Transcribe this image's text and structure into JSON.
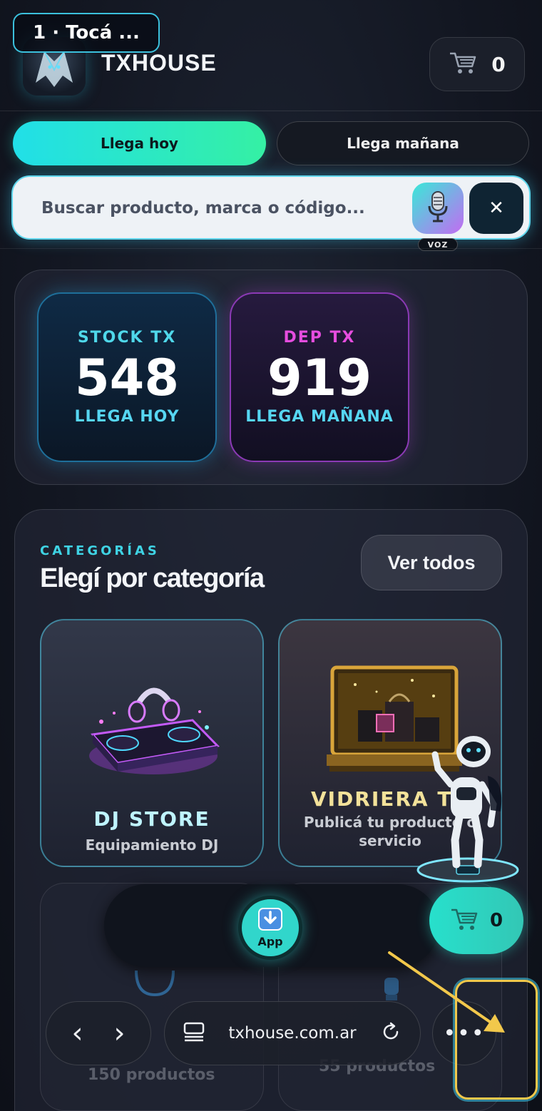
{
  "tutorial": {
    "step_label": "1 · Tocá ..."
  },
  "header": {
    "brand": "TXHOUSE",
    "cart_count": "0"
  },
  "tabs": [
    {
      "label": "Llega hoy",
      "active": true
    },
    {
      "label": "Llega mañana",
      "active": false
    }
  ],
  "search": {
    "placeholder": "Buscar producto, marca o código...",
    "voice_label": "VOZ",
    "clear_label": "✕"
  },
  "stats": [
    {
      "label": "STOCK TX",
      "value": "548",
      "sub": "LLEGA HOY"
    },
    {
      "label": "DEP TX",
      "value": "919",
      "sub": "LLEGA MAÑANA"
    }
  ],
  "categories": {
    "kicker": "CATEGORÍAS",
    "title": "Elegí por categoría",
    "see_all": "Ver todos",
    "cards": [
      {
        "name": "DJ STORE",
        "desc": "Equipamiento DJ"
      },
      {
        "name": "VIDRIERA TX",
        "desc": "Publicá tu producto o servicio"
      }
    ],
    "partial_cards": [
      {
        "count": "150 productos"
      },
      {
        "count": "55 productos"
      }
    ]
  },
  "dock": {
    "app_label": "App",
    "cart_count": "0"
  },
  "browser": {
    "back": "‹",
    "forward": "›",
    "url": "txhouse.com.ar",
    "more": "•••"
  },
  "colors": {
    "accent_cyan": "#21dfe8",
    "accent_green": "#35f0a4",
    "magenta": "#e64ddf",
    "highlight_yellow": "#f2c84b"
  }
}
